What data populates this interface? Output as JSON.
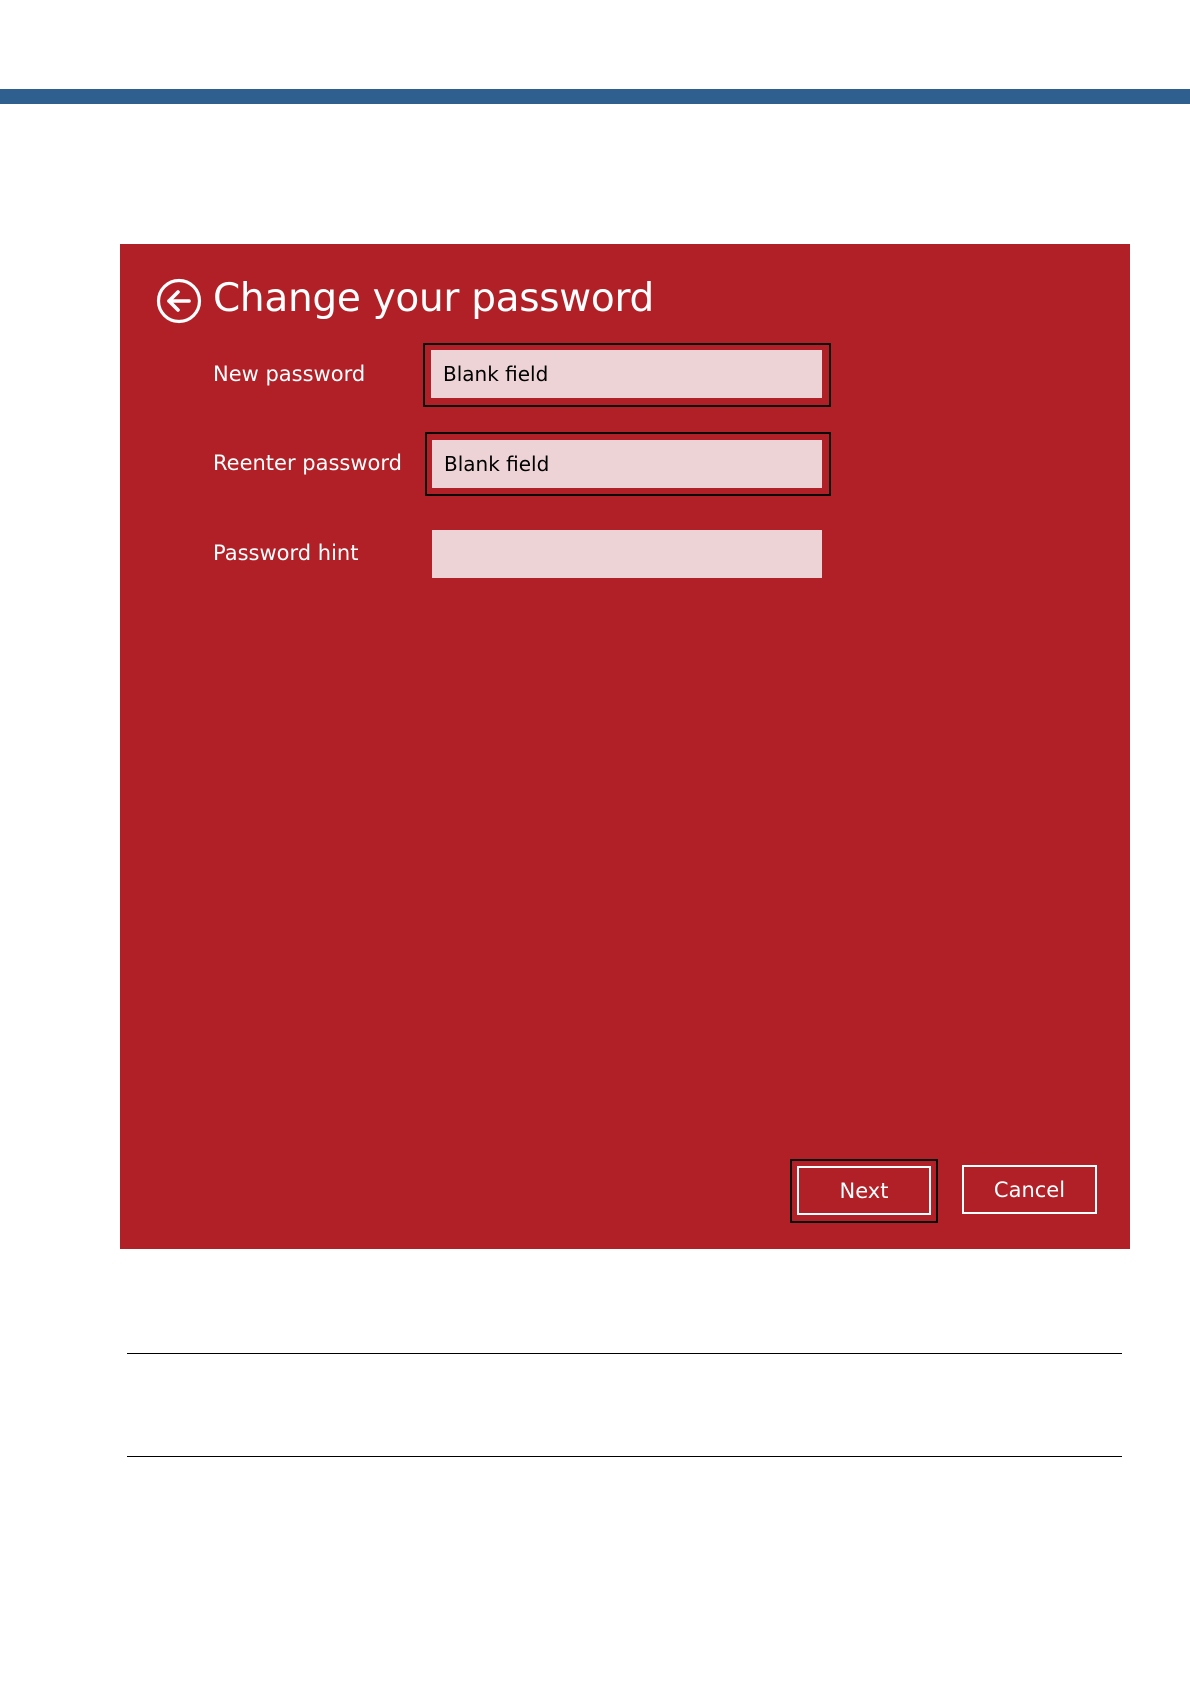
{
  "header": {
    "bar_color": "#2f5f8f"
  },
  "dialog": {
    "background": "#b22027",
    "title": "Change your password",
    "back_icon": "arrow-left-circle-icon",
    "fields": {
      "new_password": {
        "label": "New password",
        "placeholder": "Blank field",
        "value": ""
      },
      "reenter_password": {
        "label": "Reenter password",
        "placeholder": "Blank field",
        "value": ""
      },
      "password_hint": {
        "label": "Password hint",
        "placeholder": "",
        "value": ""
      }
    },
    "buttons": {
      "next": "Next",
      "cancel": "Cancel"
    }
  }
}
